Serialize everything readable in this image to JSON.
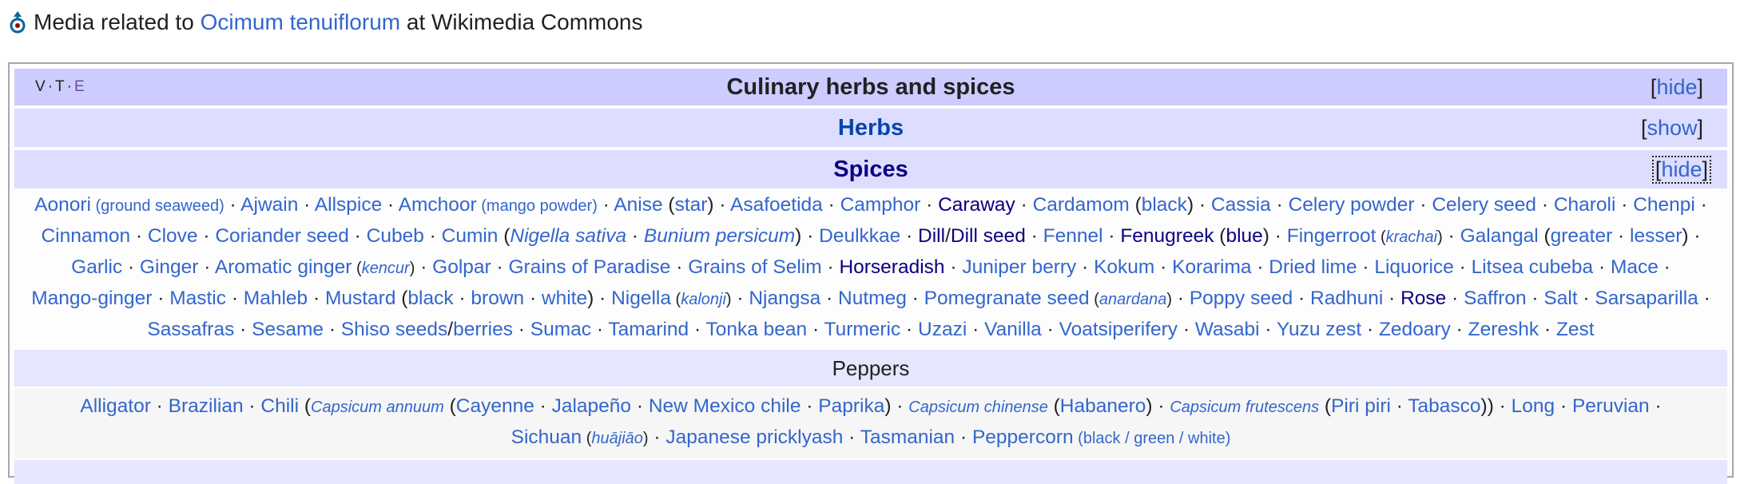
{
  "commons": {
    "prefix": "Media related to",
    "link": "Ocimum tenuiflorum",
    "suffix": "at Wikimedia Commons",
    "icon": "wikimedia-commons-icon"
  },
  "navbox": {
    "vte": [
      "V",
      "T",
      "E"
    ],
    "title": "Culinary herbs and spices",
    "title_toggle": "hide",
    "herbs": {
      "title": "Herbs",
      "toggle": "show"
    },
    "spices": {
      "title": "Spices",
      "toggle": "hide"
    },
    "spices_lines": [
      [
        {
          "t": "Aonori"
        },
        {
          "t": " (ground seaweed)",
          "k": "sm"
        },
        {
          "s": 1
        },
        {
          "t": "Ajwain"
        },
        {
          "s": 1
        },
        {
          "t": "Allspice"
        },
        {
          "s": 1
        },
        {
          "t": "Amchoor"
        },
        {
          "t": " (mango powder)",
          "k": "sm"
        },
        {
          "s": 1
        },
        {
          "t": "Anise"
        },
        {
          "p": " ("
        },
        {
          "t": "star"
        },
        {
          "p": ")"
        },
        {
          "s": 1
        },
        {
          "t": "Asafoetida"
        },
        {
          "s": 1
        },
        {
          "t": "Camphor"
        },
        {
          "s": 1
        },
        {
          "t": "Caraway",
          "k": "vis"
        },
        {
          "s": 1
        },
        {
          "t": "Cardamom"
        },
        {
          "p": " ("
        },
        {
          "t": "black"
        },
        {
          "p": ")"
        },
        {
          "s": 1
        },
        {
          "t": "Cassia"
        },
        {
          "s": 1
        },
        {
          "t": "Celery powder"
        },
        {
          "s": 1
        },
        {
          "t": "Celery seed"
        },
        {
          "s": 1
        },
        {
          "t": "Charoli"
        },
        {
          "s": 1
        },
        {
          "t": "Chenpi"
        },
        {
          "s": 1
        }
      ],
      [
        {
          "t": "Cinnamon"
        },
        {
          "s": 1
        },
        {
          "t": "Clove"
        },
        {
          "s": 1
        },
        {
          "t": "Coriander seed"
        },
        {
          "s": 1
        },
        {
          "t": "Cubeb"
        },
        {
          "s": 1
        },
        {
          "t": "Cumin"
        },
        {
          "p": " ("
        },
        {
          "t": "Nigella sativa",
          "k": "i"
        },
        {
          "s": 1
        },
        {
          "t": "Bunium persicum",
          "k": "i"
        },
        {
          "p": ")"
        },
        {
          "s": 1
        },
        {
          "t": "Deulkkae"
        },
        {
          "s": 1
        },
        {
          "t": "Dill",
          "k": "vis"
        },
        {
          "p": "/"
        },
        {
          "t": "Dill seed",
          "k": "vis"
        },
        {
          "s": 1
        },
        {
          "t": "Fennel"
        },
        {
          "s": 1
        },
        {
          "t": "Fenugreek",
          "k": "vis"
        },
        {
          "p": " ("
        },
        {
          "t": "blue",
          "k": "vis"
        },
        {
          "p": ")"
        },
        {
          "s": 1
        },
        {
          "t": "Fingerroot"
        },
        {
          "t": " (",
          "k": "sm"
        },
        {
          "t": "krachai",
          "k": "smi"
        },
        {
          "t": ")",
          "k": "sm"
        },
        {
          "s": 1
        },
        {
          "t": "Galangal"
        },
        {
          "p": " ("
        },
        {
          "t": "greater"
        },
        {
          "s": 1
        },
        {
          "t": "lesser"
        },
        {
          "p": ")"
        },
        {
          "s": 1
        }
      ],
      [
        {
          "t": "Garlic"
        },
        {
          "s": 1
        },
        {
          "t": "Ginger"
        },
        {
          "s": 1
        },
        {
          "t": "Aromatic ginger"
        },
        {
          "t": " (",
          "k": "sm"
        },
        {
          "t": "kencur",
          "k": "smi"
        },
        {
          "t": ")",
          "k": "sm"
        },
        {
          "s": 1
        },
        {
          "t": "Golpar"
        },
        {
          "s": 1
        },
        {
          "t": "Grains of Paradise"
        },
        {
          "s": 1
        },
        {
          "t": "Grains of Selim"
        },
        {
          "s": 1
        },
        {
          "t": "Horseradish",
          "k": "vis"
        },
        {
          "s": 1
        },
        {
          "t": "Juniper berry"
        },
        {
          "s": 1
        },
        {
          "t": "Kokum"
        },
        {
          "s": 1
        },
        {
          "t": "Korarima"
        },
        {
          "s": 1
        },
        {
          "t": "Dried lime"
        },
        {
          "s": 1
        },
        {
          "t": "Liquorice"
        },
        {
          "s": 1
        },
        {
          "t": "Litsea cubeba"
        },
        {
          "s": 1
        },
        {
          "t": "Mace"
        },
        {
          "s": 1
        }
      ],
      [
        {
          "t": "Mango-ginger"
        },
        {
          "s": 1
        },
        {
          "t": "Mastic"
        },
        {
          "s": 1
        },
        {
          "t": "Mahleb"
        },
        {
          "s": 1
        },
        {
          "t": "Mustard"
        },
        {
          "p": " ("
        },
        {
          "t": "black"
        },
        {
          "s": 1
        },
        {
          "t": "brown"
        },
        {
          "s": 1
        },
        {
          "t": "white"
        },
        {
          "p": ")"
        },
        {
          "s": 1
        },
        {
          "t": "Nigella"
        },
        {
          "t": " (",
          "k": "sm"
        },
        {
          "t": "kalonji",
          "k": "smi"
        },
        {
          "t": ")",
          "k": "sm"
        },
        {
          "s": 1
        },
        {
          "t": "Njangsa"
        },
        {
          "s": 1
        },
        {
          "t": "Nutmeg"
        },
        {
          "s": 1
        },
        {
          "t": "Pomegranate seed"
        },
        {
          "t": " (",
          "k": "sm"
        },
        {
          "t": "anardana",
          "k": "smi"
        },
        {
          "t": ")",
          "k": "sm"
        },
        {
          "s": 1
        },
        {
          "t": "Poppy seed"
        },
        {
          "s": 1
        },
        {
          "t": "Radhuni"
        },
        {
          "s": 1
        },
        {
          "t": "Rose",
          "k": "vis"
        },
        {
          "s": 1
        },
        {
          "t": "Saffron"
        },
        {
          "s": 1
        },
        {
          "t": "Salt"
        },
        {
          "s": 1
        },
        {
          "t": "Sarsaparilla"
        },
        {
          "s": 1
        }
      ],
      [
        {
          "t": "Sassafras"
        },
        {
          "s": 1
        },
        {
          "t": "Sesame"
        },
        {
          "s": 1
        },
        {
          "t": "Shiso seeds"
        },
        {
          "p": "/"
        },
        {
          "t": "berries"
        },
        {
          "s": 1
        },
        {
          "t": "Sumac"
        },
        {
          "s": 1
        },
        {
          "t": "Tamarind"
        },
        {
          "s": 1
        },
        {
          "t": "Tonka bean"
        },
        {
          "s": 1
        },
        {
          "t": "Turmeric"
        },
        {
          "s": 1
        },
        {
          "t": "Uzazi"
        },
        {
          "s": 1
        },
        {
          "t": "Vanilla"
        },
        {
          "s": 1
        },
        {
          "t": "Voatsiperifery"
        },
        {
          "s": 1
        },
        {
          "t": "Wasabi"
        },
        {
          "s": 1
        },
        {
          "t": "Yuzu zest"
        },
        {
          "s": 1
        },
        {
          "t": "Zedoary"
        },
        {
          "s": 1
        },
        {
          "t": "Zereshk"
        },
        {
          "s": 1
        },
        {
          "t": "Zest"
        }
      ]
    ],
    "peppers": {
      "title": "Peppers",
      "lines": [
        [
          {
            "t": "Alligator"
          },
          {
            "s": 1
          },
          {
            "t": "Brazilian"
          },
          {
            "s": 1
          },
          {
            "t": "Chili"
          },
          {
            "p": " ("
          },
          {
            "t": "Capsicum annuum",
            "k": "smi"
          },
          {
            "p": " ("
          },
          {
            "t": "Cayenne"
          },
          {
            "s": 1
          },
          {
            "t": "Jalapeño"
          },
          {
            "s": 1
          },
          {
            "t": "New Mexico chile"
          },
          {
            "s": 1
          },
          {
            "t": "Paprika"
          },
          {
            "p": ")"
          },
          {
            "s": 1
          },
          {
            "t": "Capsicum chinense",
            "k": "smi"
          },
          {
            "p": " ("
          },
          {
            "t": "Habanero"
          },
          {
            "p": ")"
          },
          {
            "s": 1
          },
          {
            "t": "Capsicum frutescens",
            "k": "smi"
          },
          {
            "p": " ("
          },
          {
            "t": "Piri piri"
          },
          {
            "s": 1
          },
          {
            "t": "Tabasco"
          },
          {
            "p": "))"
          },
          {
            "s": 1
          },
          {
            "t": "Long"
          },
          {
            "s": 1
          },
          {
            "t": "Peruvian"
          },
          {
            "s": 1
          }
        ],
        [
          {
            "t": "Sichuan"
          },
          {
            "t": " (",
            "k": "sm"
          },
          {
            "t": "huājiāo",
            "k": "smi"
          },
          {
            "t": ")",
            "k": "sm"
          },
          {
            "s": 1
          },
          {
            "t": "Japanese pricklyash"
          },
          {
            "s": 1
          },
          {
            "t": "Tasmanian"
          },
          {
            "s": 1
          },
          {
            "t": "Peppercorn"
          },
          {
            "t": " (black / green / white)",
            "k": "sm"
          }
        ]
      ]
    }
  }
}
